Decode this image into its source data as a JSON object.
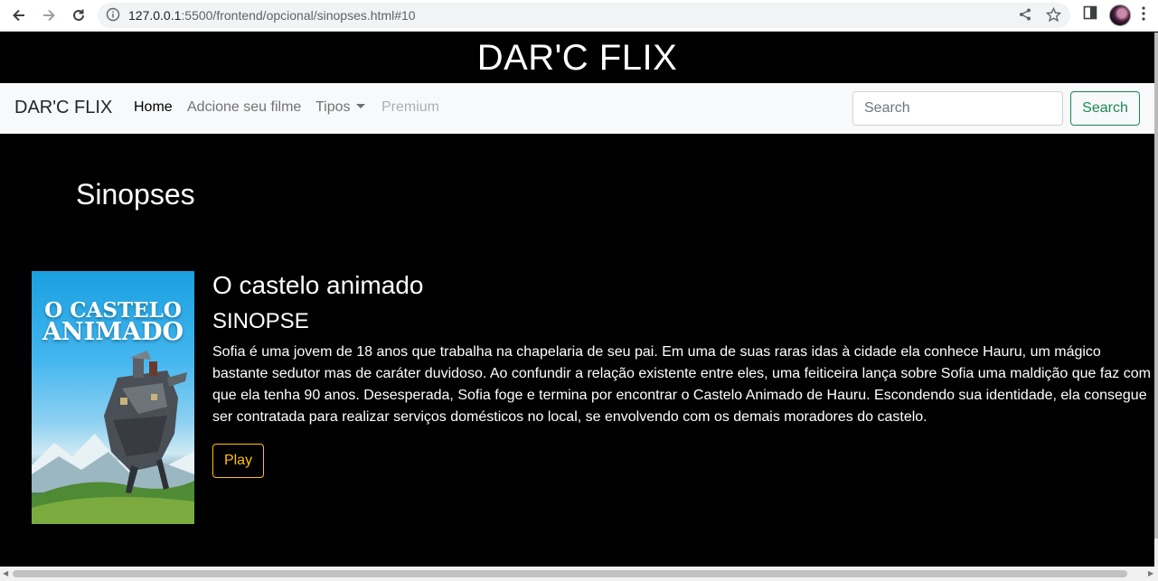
{
  "browser": {
    "url_host": "127.0.0.1",
    "url_rest": ":5500/frontend/opcional/sinopses.html#10"
  },
  "site": {
    "header_title": "DAR'C FLIX",
    "brand": "DAR'C FLIX"
  },
  "nav": {
    "home": "Home",
    "add_movie": "Adcione seu filme",
    "types": "Tipos",
    "premium": "Premium"
  },
  "search": {
    "placeholder": "Search",
    "button": "Search"
  },
  "main": {
    "section_title": "Sinopses",
    "movie": {
      "poster_line1": "O CASTELO",
      "poster_line2": "ANIMADO",
      "title": "O castelo animado",
      "synopsis_label": "SINOPSE",
      "synopsis": "Sofia é uma jovem de 18 anos que trabalha na chapelaria de seu pai. Em uma de suas raras idas à cidade ela conhece Hauru, um mágico bastante sedutor mas de caráter duvidoso. Ao confundir a relação existente entre eles, uma feiticeira lança sobre Sofia uma maldição que faz com que ela tenha 90 anos. Desesperada, Sofia foge e termina por encontrar o Castelo Animado de Hauru. Escondendo sua identidade, ela consegue ser contratada para realizar serviços domésticos no local, se envolvendo com os demais moradores do castelo.",
      "play": "Play"
    }
  },
  "colors": {
    "search_button": "#198754",
    "play_button": "#ffc107",
    "navbar_bg": "#f8f9fa",
    "page_bg": "#000000"
  }
}
